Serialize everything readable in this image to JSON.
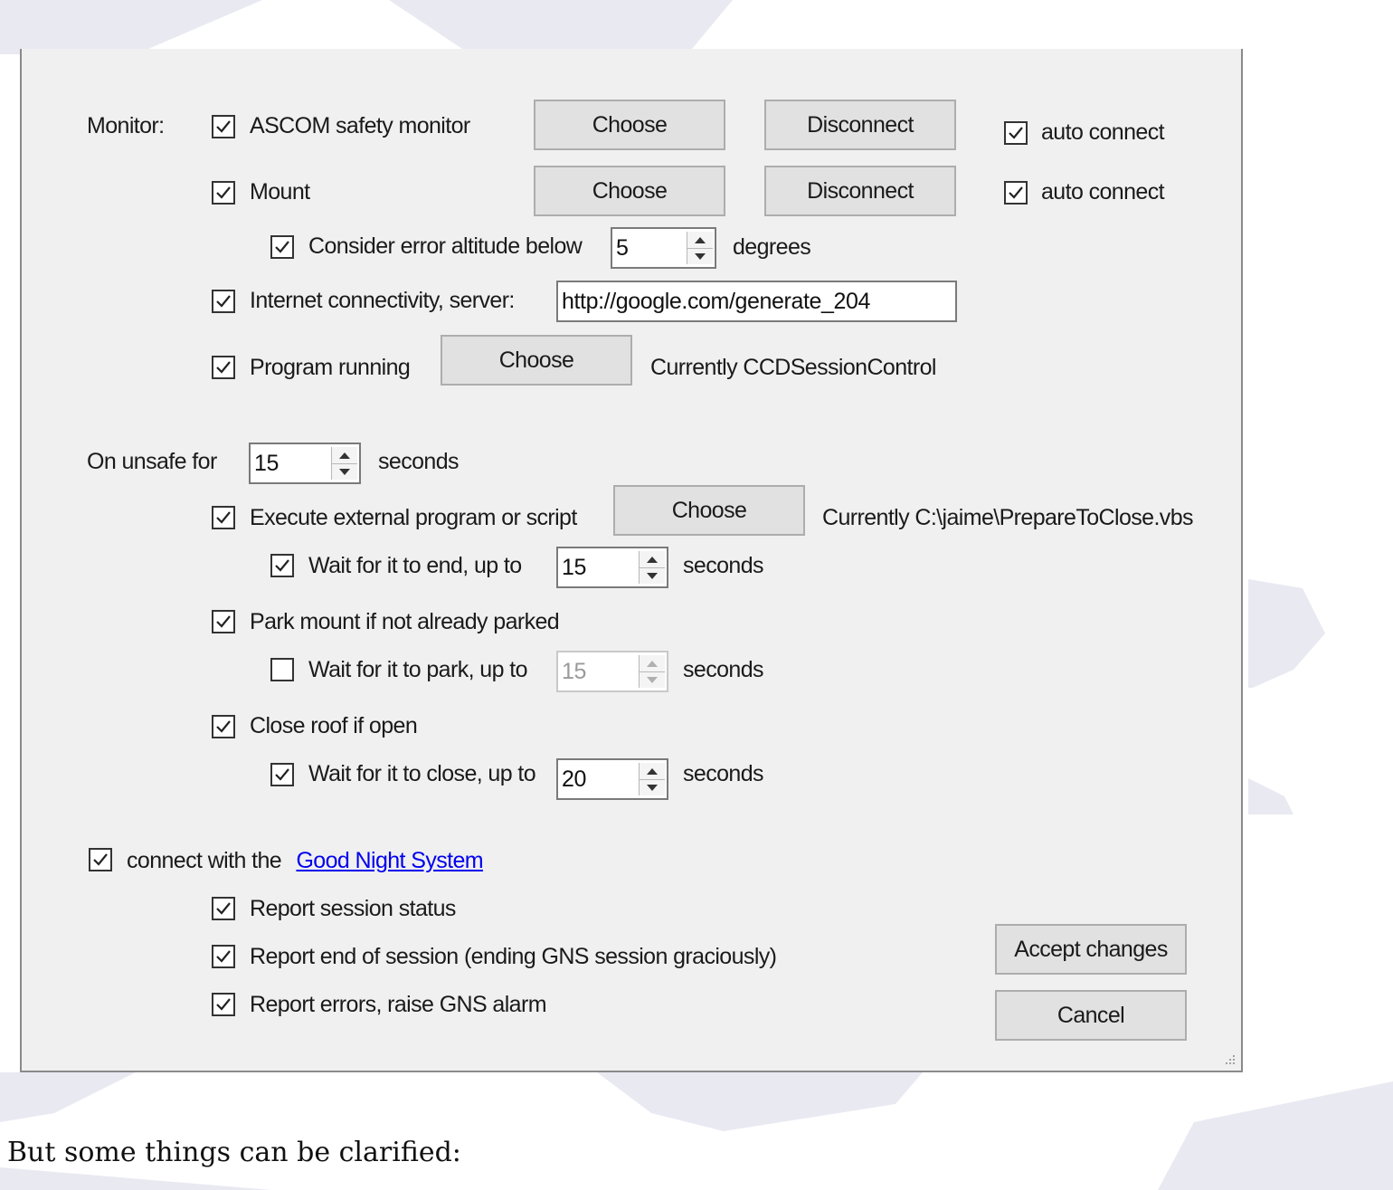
{
  "monitor": {
    "label": "Monitor:",
    "ascom": {
      "label": "ASCOM safety monitor",
      "checked": true,
      "choose": "Choose",
      "disconnect": "Disconnect",
      "auto_connect": "auto connect",
      "auto_checked": true
    },
    "mount": {
      "label": "Mount",
      "checked": true,
      "choose": "Choose",
      "disconnect": "Disconnect",
      "auto_connect": "auto connect",
      "auto_checked": true
    },
    "altitude": {
      "label": "Consider error altitude below",
      "checked": true,
      "value": "5",
      "unit": "degrees"
    },
    "internet": {
      "label": "Internet connectivity, server:",
      "checked": true,
      "server": "http://google.com/generate_204"
    },
    "program": {
      "label": "Program running",
      "checked": true,
      "choose": "Choose",
      "current": "Currently CCDSessionControl"
    }
  },
  "unsafe": {
    "label": "On unsafe for",
    "value": "15",
    "unit": "seconds",
    "execute": {
      "label": "Execute external program or script",
      "checked": true,
      "choose": "Choose",
      "current": "Currently C:\\jaime\\PrepareToClose.vbs"
    },
    "wait_end": {
      "label": "Wait for it to end, up to",
      "checked": true,
      "value": "15",
      "unit": "seconds"
    },
    "park": {
      "label": "Park mount if not already parked",
      "checked": true
    },
    "wait_park": {
      "label": "Wait for it to park, up to",
      "checked": false,
      "value": "15",
      "unit": "seconds"
    },
    "roof": {
      "label": "Close roof if open",
      "checked": true
    },
    "wait_close": {
      "label": "Wait for it to close, up to",
      "checked": true,
      "value": "20",
      "unit": "seconds"
    }
  },
  "gns": {
    "prefix": "connect with the",
    "link": "Good Night System",
    "checked": true,
    "report_status": "Report session status",
    "report_end": "Report end of session (ending GNS session graciously)",
    "report_errors": "Report errors, raise GNS alarm"
  },
  "buttons": {
    "accept": "Accept changes",
    "cancel": "Cancel"
  },
  "caption": "But some things can be clarified:"
}
